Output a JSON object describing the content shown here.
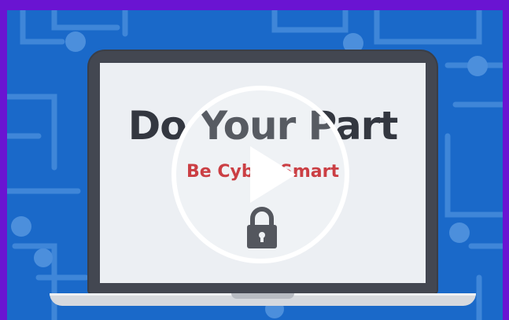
{
  "video": {
    "headline": "Do Your Part",
    "subhead": "Be Cyber Smart",
    "play_icon": "play-icon",
    "lock_icon": "padlock-icon"
  },
  "colors": {
    "frame": "#6a14d2",
    "background": "#1a69c9",
    "headline": "#333740",
    "subhead": "#c0151b",
    "screen": "#eceff3"
  }
}
